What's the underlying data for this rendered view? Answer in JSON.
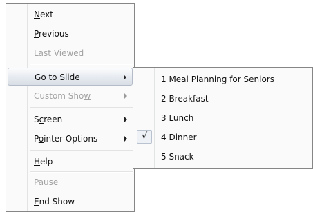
{
  "main_menu": {
    "items": [
      {
        "label": "Next",
        "mnemonic": "N"
      },
      {
        "label": "Previous",
        "mnemonic": "P"
      },
      {
        "label": "Last Viewed",
        "mnemonic": "V",
        "disabled": true
      },
      {
        "label": "Go to Slide",
        "mnemonic": "G",
        "submenu": true,
        "highlighted": true
      },
      {
        "label": "Custom Show",
        "mnemonic": "w",
        "submenu": true,
        "disabled": true
      },
      {
        "label": "Screen",
        "mnemonic": "c",
        "submenu": true
      },
      {
        "label": "Pointer Options",
        "mnemonic": "o",
        "submenu": true
      },
      {
        "label": "Help",
        "mnemonic": "H"
      },
      {
        "label": "Pause",
        "mnemonic": "s",
        "disabled": true
      },
      {
        "label": "End Show",
        "mnemonic": "E"
      }
    ]
  },
  "submenu": {
    "items": [
      {
        "label": "1 Meal Planning for Seniors",
        "checked": false
      },
      {
        "label": "2 Breakfast",
        "checked": false
      },
      {
        "label": "3 Lunch",
        "checked": false
      },
      {
        "label": "4 Dinner",
        "checked": true
      },
      {
        "label": "5 Snack",
        "checked": false
      }
    ],
    "check_glyph": "√"
  },
  "colors": {
    "menu_background": "#fafafa",
    "menu_border": "#868686",
    "disabled_text": "#a3a3a3",
    "highlight_border": "#b3bcc8"
  }
}
